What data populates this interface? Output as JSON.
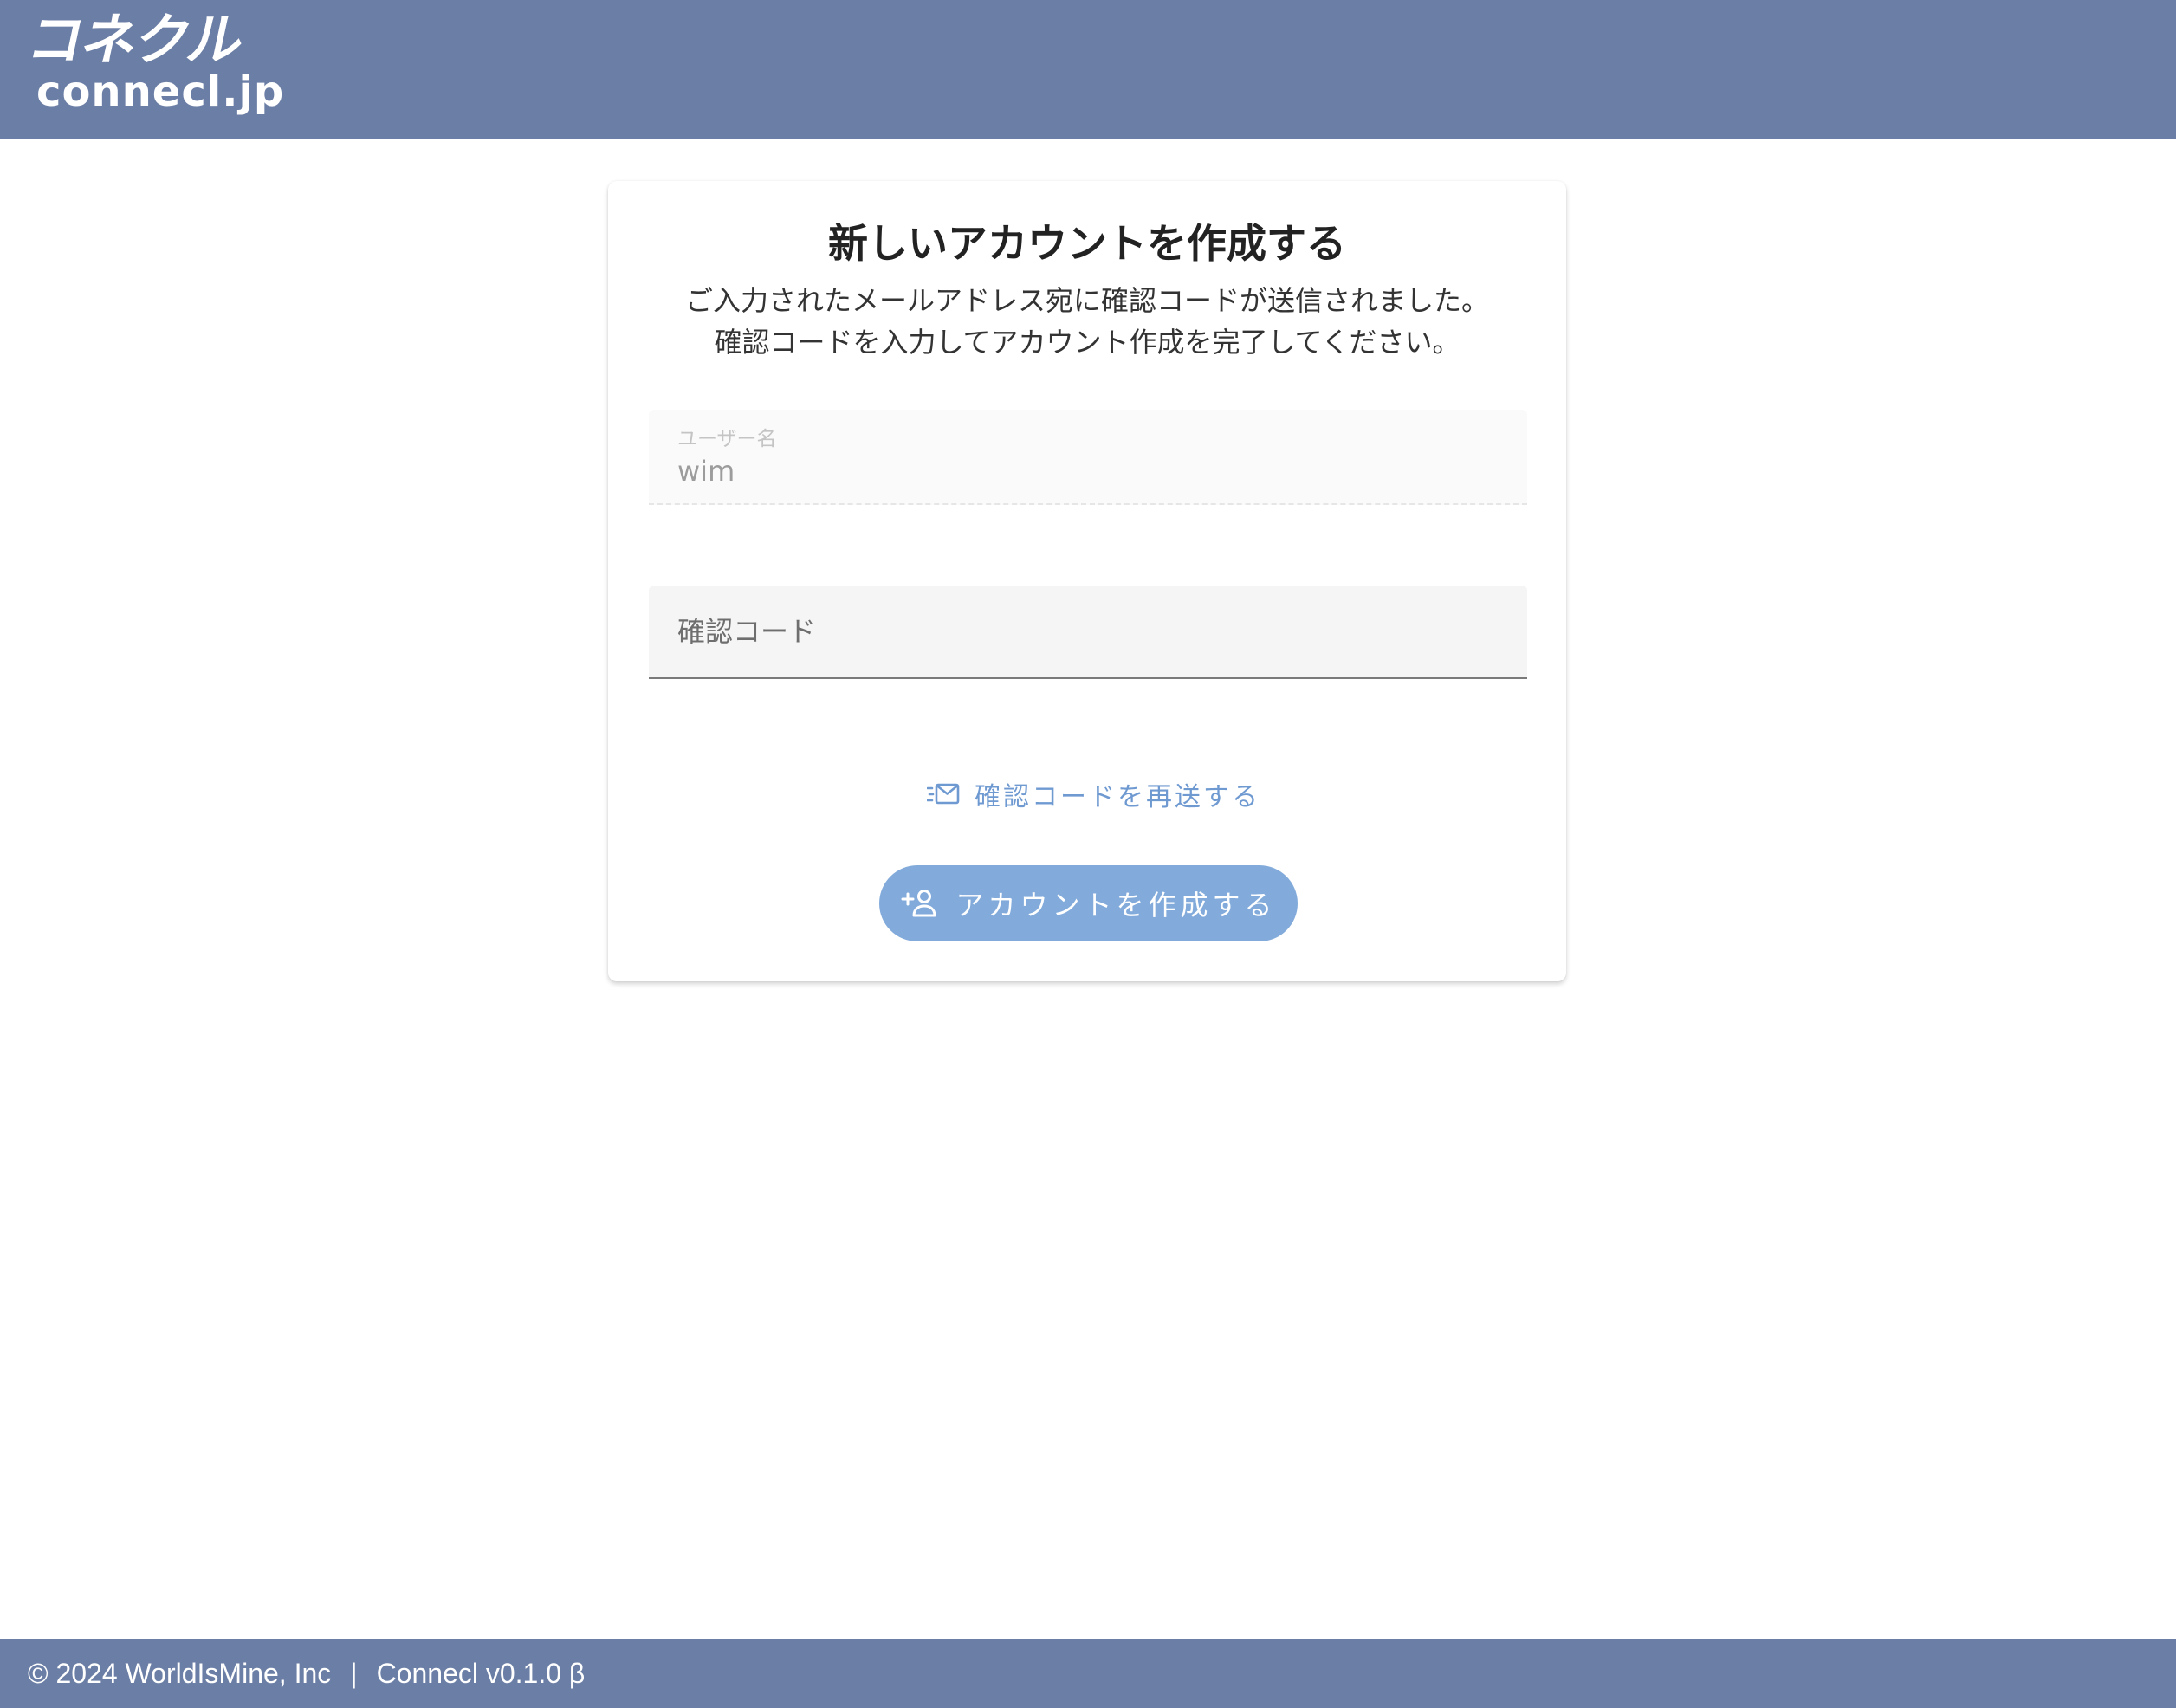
{
  "header": {
    "logo_jp": "コネクル",
    "logo_en": "connecl.jp"
  },
  "card": {
    "title": "新しいアカウントを作成する",
    "description_line1": "ご入力されたメールアドレス宛に確認コードが送信されました。",
    "description_line2": "確認コードを入力してアカウント作成を完了してください。"
  },
  "form": {
    "username_label": "ユーザー名",
    "username_value": "wim",
    "code_placeholder": "確認コード",
    "code_value": ""
  },
  "actions": {
    "resend_label": "確認コードを再送する",
    "resend_icon": "mail-send-icon",
    "create_label": "アカウントを作成する",
    "create_icon": "person-add-icon"
  },
  "footer": {
    "copyright": "© 2024 WorldIsMine, Inc",
    "separator": "|",
    "version": "Connecl v0.1.0 β"
  },
  "colors": {
    "header_bg": "#6b7ea5",
    "button_bg": "#82abdb",
    "link": "#6f9ad1"
  }
}
